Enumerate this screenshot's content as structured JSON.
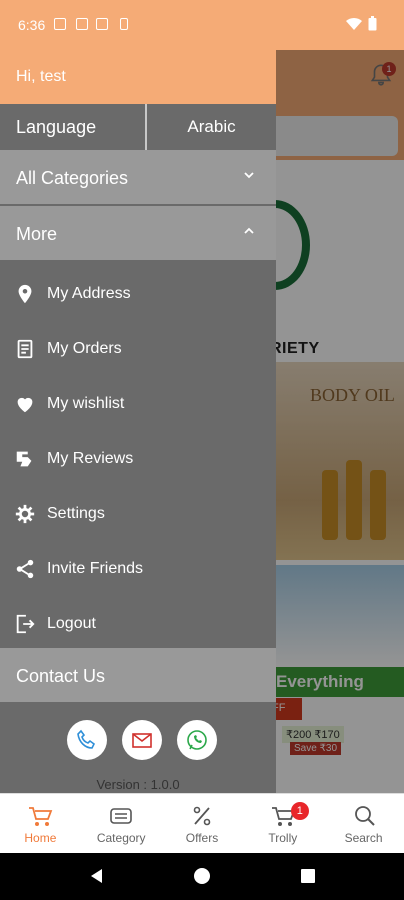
{
  "status_bar": {
    "time": "6:36"
  },
  "background_app": {
    "bell_badge": "1",
    "brand_text": "RIETY",
    "banner_text": "BODY OIL",
    "green_strip": "Everything",
    "red_strip": "FF",
    "price_tag": "₹200 ₹170",
    "save_tag": "Save ₹30"
  },
  "drawer": {
    "greeting": "Hi, test",
    "language_label": "Language",
    "language_value": "Arabic",
    "sections": {
      "all_categories": "All Categories",
      "more": "More",
      "contact_us": "Contact Us"
    },
    "menu": [
      {
        "label": "My Address",
        "icon": "location-pin-icon"
      },
      {
        "label": "My Orders",
        "icon": "orders-list-icon"
      },
      {
        "label": "My wishlist",
        "icon": "heart-icon"
      },
      {
        "label": "My Reviews",
        "icon": "reviews-icon"
      },
      {
        "label": "Settings",
        "icon": "gear-icon"
      },
      {
        "label": "Invite Friends",
        "icon": "share-icon"
      },
      {
        "label": "Logout",
        "icon": "logout-icon"
      }
    ],
    "version": "Version : 1.0.0",
    "colors": {
      "header": "#f5ab76",
      "drawer_bg": "#6a6a6a",
      "section_bg": "#999999",
      "phone": "#2f8fd8",
      "mail": "#d0312d",
      "whatsapp": "#2ca84a"
    }
  },
  "bottom_nav": {
    "items": [
      {
        "label": "Home",
        "icon": "home-cart-icon",
        "active": true
      },
      {
        "label": "Category",
        "icon": "category-icon"
      },
      {
        "label": "Offers",
        "icon": "percent-icon"
      },
      {
        "label": "Trolly",
        "icon": "cart-icon",
        "badge": "1"
      },
      {
        "label": "Search",
        "icon": "search-icon"
      }
    ],
    "accent": "#f07a3a"
  }
}
